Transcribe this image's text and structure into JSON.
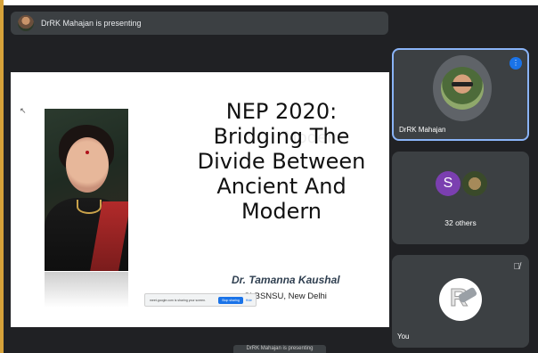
{
  "presenter_bar": {
    "text": "DrRK Mahajan is presenting"
  },
  "slide": {
    "title_lines": [
      "NEP 2020:",
      "Bridging The",
      "Divide Between",
      "Ancient And",
      "Modern"
    ],
    "author": "Dr. Tamanna Kaushal",
    "affiliation": "SLBSNSU, New Delhi",
    "share_message": "meet.google.com is sharing your screen.",
    "stop_sharing_label": "Stop sharing",
    "hide_label": "Hide"
  },
  "bottom_caption": "DrRK Mahajan is presenting",
  "tiles": {
    "presenter": {
      "name": "DrRK Mahajan"
    },
    "others": {
      "avatar_letter": "S",
      "label": "32 others"
    },
    "you": {
      "name": "You"
    }
  },
  "colors": {
    "background": "#202124",
    "tile": "#3c4043",
    "active_border": "#8ab4f8",
    "accent": "#1a73e8",
    "avatar_s": "#7b3fb0"
  },
  "icons": [
    "speaking-indicator-icon",
    "mic-off-icon",
    "cursor-icon"
  ]
}
